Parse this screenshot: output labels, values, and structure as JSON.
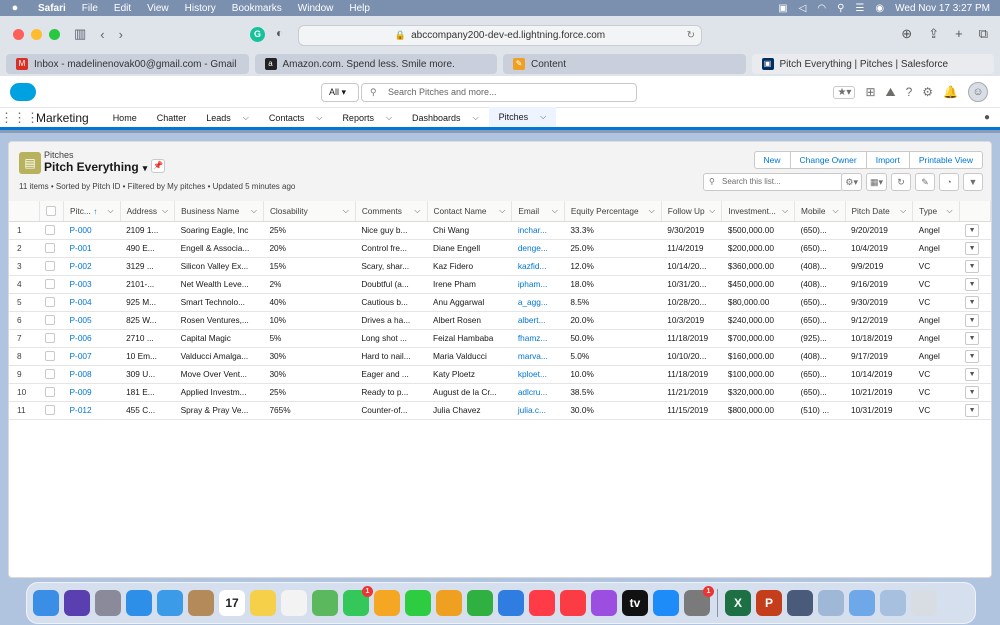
{
  "menubar": {
    "app": "Safari",
    "items": [
      "File",
      "Edit",
      "View",
      "History",
      "Bookmarks",
      "Window",
      "Help"
    ],
    "clock": "Wed Nov 17  3:27 PM"
  },
  "browser": {
    "address": "abccompany200-dev-ed.lightning.force.com",
    "tabs": [
      {
        "label": "Inbox - madelinenovak00@gmail.com - Gmail",
        "favicon": "gmail-icon",
        "color": "#d93025"
      },
      {
        "label": "Amazon.com. Spend less. Smile more.",
        "favicon": "amazon-icon",
        "color": "#222222"
      },
      {
        "label": "Content",
        "favicon": "content-icon",
        "color": "#f0a020"
      },
      {
        "label": "Pitch Everything | Pitches | Salesforce",
        "favicon": "salesforce-tab-icon",
        "color": "#032d60"
      }
    ]
  },
  "sf": {
    "search_scope": "All",
    "search_placeholder": "Search Pitches and more...",
    "app_name": "Marketing",
    "nav": [
      {
        "label": "Home",
        "chev": false
      },
      {
        "label": "Chatter",
        "chev": false
      },
      {
        "label": "Leads",
        "chev": true
      },
      {
        "label": "Contacts",
        "chev": true
      },
      {
        "label": "Reports",
        "chev": true
      },
      {
        "label": "Dashboards",
        "chev": true
      },
      {
        "label": "Pitches",
        "chev": true,
        "active": true
      }
    ]
  },
  "list": {
    "object_label": "Pitches",
    "title": "Pitch Everything",
    "meta": "11 items • Sorted by Pitch ID • Filtered by My pitches • Updated 5 minutes ago",
    "buttons": [
      "New",
      "Change Owner",
      "Import",
      "Printable View"
    ],
    "search_placeholder": "Search this list...",
    "columns": [
      "Pitc...",
      "Address",
      "Business Name",
      "Closability",
      "Comments",
      "Contact Name",
      "Email",
      "Equity Percentage",
      "Follow Up",
      "Investment...",
      "Mobile",
      "Pitch Date",
      "Type"
    ],
    "rows": [
      [
        "1",
        "P-000",
        "2109 1...",
        "Soaring Eagle, Inc",
        "25%",
        "Nice guy b...",
        "Chi Wang",
        "inchar...",
        "33.3%",
        "9/30/2019",
        "$500,000.00",
        "(650)...",
        "9/20/2019",
        "Angel"
      ],
      [
        "2",
        "P-001",
        "490 E...",
        "Engell & Associa...",
        "20%",
        "Control fre...",
        "Diane Engell",
        "denge...",
        "25.0%",
        "11/4/2019",
        "$200,000.00",
        "(650)...",
        "10/4/2019",
        "Angel"
      ],
      [
        "3",
        "P-002",
        "3129 ...",
        "Silicon Valley Ex...",
        "15%",
        "Scary, shar...",
        "Kaz Fidero",
        "kazfid...",
        "12.0%",
        "10/14/20...",
        "$360,000.00",
        "(408)...",
        "9/9/2019",
        "VC"
      ],
      [
        "4",
        "P-003",
        "2101-...",
        "Net Wealth Leve...",
        "2%",
        "Doubtful (a...",
        "Irene Pham",
        "ipham...",
        "18.0%",
        "10/31/20...",
        "$450,000.00",
        "(408)...",
        "9/16/2019",
        "VC"
      ],
      [
        "5",
        "P-004",
        "925 M...",
        "Smart Technolo...",
        "40%",
        "Cautious b...",
        "Anu Aggarwal",
        "a_agg...",
        "8.5%",
        "10/28/20...",
        "$80,000.00",
        "(650)...",
        "9/30/2019",
        "VC"
      ],
      [
        "6",
        "P-005",
        "825 W...",
        "Rosen Ventures,...",
        "10%",
        "Drives a ha...",
        "Albert Rosen",
        "albert...",
        "20.0%",
        "10/3/2019",
        "$240,000.00",
        "(650)...",
        "9/12/2019",
        "Angel"
      ],
      [
        "7",
        "P-006",
        "2710 ...",
        "Capital Magic",
        "5%",
        "Long shot ...",
        "Feizal Hambaba",
        "fhamz...",
        "50.0%",
        "11/18/2019",
        "$700,000.00",
        "(925)...",
        "10/18/2019",
        "Angel"
      ],
      [
        "8",
        "P-007",
        "10 Em...",
        "Valducci Amalga...",
        "30%",
        "Hard to nail...",
        "Maria Valducci",
        "marva...",
        "5.0%",
        "10/10/20...",
        "$160,000.00",
        "(408)...",
        "9/17/2019",
        "Angel"
      ],
      [
        "9",
        "P-008",
        "309 U...",
        "Move Over Vent...",
        "30%",
        "Eager and ...",
        "Katy Ploetz",
        "kploet...",
        "10.0%",
        "11/18/2019",
        "$100,000.00",
        "(650)...",
        "10/14/2019",
        "VC"
      ],
      [
        "10",
        "P-009",
        "181 E...",
        "Applied Investm...",
        "25%",
        "Ready to p...",
        "August de la Cr...",
        "adlcru...",
        "38.5%",
        "11/21/2019",
        "$320,000.00",
        "(650)...",
        "10/21/2019",
        "VC"
      ],
      [
        "11",
        "P-012",
        "455 C...",
        "Spray & Pray Ve...",
        "765%",
        "Counter-of...",
        "Julia Chavez",
        "julia.c...",
        "30.0%",
        "11/15/2019",
        "$800,000.00",
        "(510) ...",
        "10/31/2019",
        "VC"
      ]
    ]
  },
  "dock": [
    {
      "name": "finder-icon",
      "color": "#3a8ee6"
    },
    {
      "name": "siri-icon",
      "color": "#5a3fb0"
    },
    {
      "name": "launchpad-icon",
      "color": "#8a8a9a"
    },
    {
      "name": "safari-icon",
      "color": "#2d8fe8"
    },
    {
      "name": "mail-icon",
      "color": "#3c9be8"
    },
    {
      "name": "contacts-icon",
      "color": "#b58a5a"
    },
    {
      "name": "calendar-icon",
      "color": "#ffffff",
      "text": "17",
      "text_color": "#222222"
    },
    {
      "name": "notes-icon",
      "color": "#f7d04a"
    },
    {
      "name": "reminders-icon",
      "color": "#f3f3f3"
    },
    {
      "name": "maps-icon",
      "color": "#5cb85c"
    },
    {
      "name": "messages-icon",
      "color": "#34c759",
      "badge": "1"
    },
    {
      "name": "photos-icon",
      "color": "#f5a623"
    },
    {
      "name": "facetime-icon",
      "color": "#2ecc40"
    },
    {
      "name": "pages-icon",
      "color": "#f0a020"
    },
    {
      "name": "numbers-icon",
      "color": "#30b040"
    },
    {
      "name": "keynote-icon",
      "color": "#2f7de1"
    },
    {
      "name": "news-icon",
      "color": "#ff3b47"
    },
    {
      "name": "music-icon",
      "color": "#fc3c44"
    },
    {
      "name": "podcasts-icon",
      "color": "#9b4ee0"
    },
    {
      "name": "tv-icon",
      "color": "#111111",
      "text": "tv"
    },
    {
      "name": "appstore-icon",
      "color": "#1d8cf8"
    },
    {
      "name": "system-preferences-icon",
      "color": "#7a7a7a",
      "badge": "1"
    },
    {
      "name": "excel-icon",
      "color": "#1d7044",
      "text": "X"
    },
    {
      "name": "powerpoint-icon",
      "color": "#c43e1c",
      "text": "P"
    },
    {
      "name": "display-icon",
      "color": "#4a5a7a"
    },
    {
      "name": "preview-icon",
      "color": "#9fb8d8"
    },
    {
      "name": "folder-icon",
      "color": "#6fa8e8"
    },
    {
      "name": "screenshot-icon",
      "color": "#a8c0e0"
    },
    {
      "name": "trash-icon",
      "color": "#d8dde4"
    }
  ]
}
